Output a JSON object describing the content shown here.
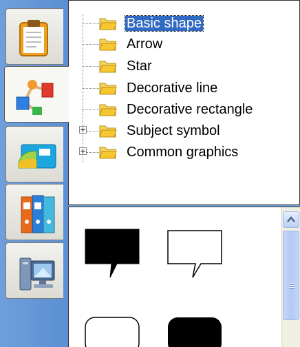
{
  "side_tabs": [
    {
      "icon": "clipboard-icon",
      "active": false
    },
    {
      "icon": "shapes-connector-icon",
      "active": true
    },
    {
      "icon": "cards-icon",
      "active": false
    },
    {
      "icon": "binders-icon",
      "active": false
    },
    {
      "icon": "computer-icon",
      "active": false
    }
  ],
  "tree": {
    "items": [
      {
        "label": "Basic shape",
        "selected": true,
        "expandable": false
      },
      {
        "label": "Arrow",
        "selected": false,
        "expandable": false
      },
      {
        "label": "Star",
        "selected": false,
        "expandable": false
      },
      {
        "label": "Decorative line",
        "selected": false,
        "expandable": false
      },
      {
        "label": "Decorative rectangle",
        "selected": false,
        "expandable": false
      },
      {
        "label": "Subject symbol",
        "selected": false,
        "expandable": true
      },
      {
        "label": "Common graphics",
        "selected": false,
        "expandable": true
      }
    ],
    "expander_glyph": "+",
    "folder_color": "#f2c94c"
  },
  "gallery": {
    "shapes": [
      "speech-bubble-black",
      "speech-bubble-outline",
      "rounded-rectangle-outline",
      "rounded-rectangle-black"
    ]
  },
  "colors": {
    "tab_strip": "#6f9fd8",
    "selection": "#316ac5",
    "scroll_thumb": "#b4c9f4"
  }
}
